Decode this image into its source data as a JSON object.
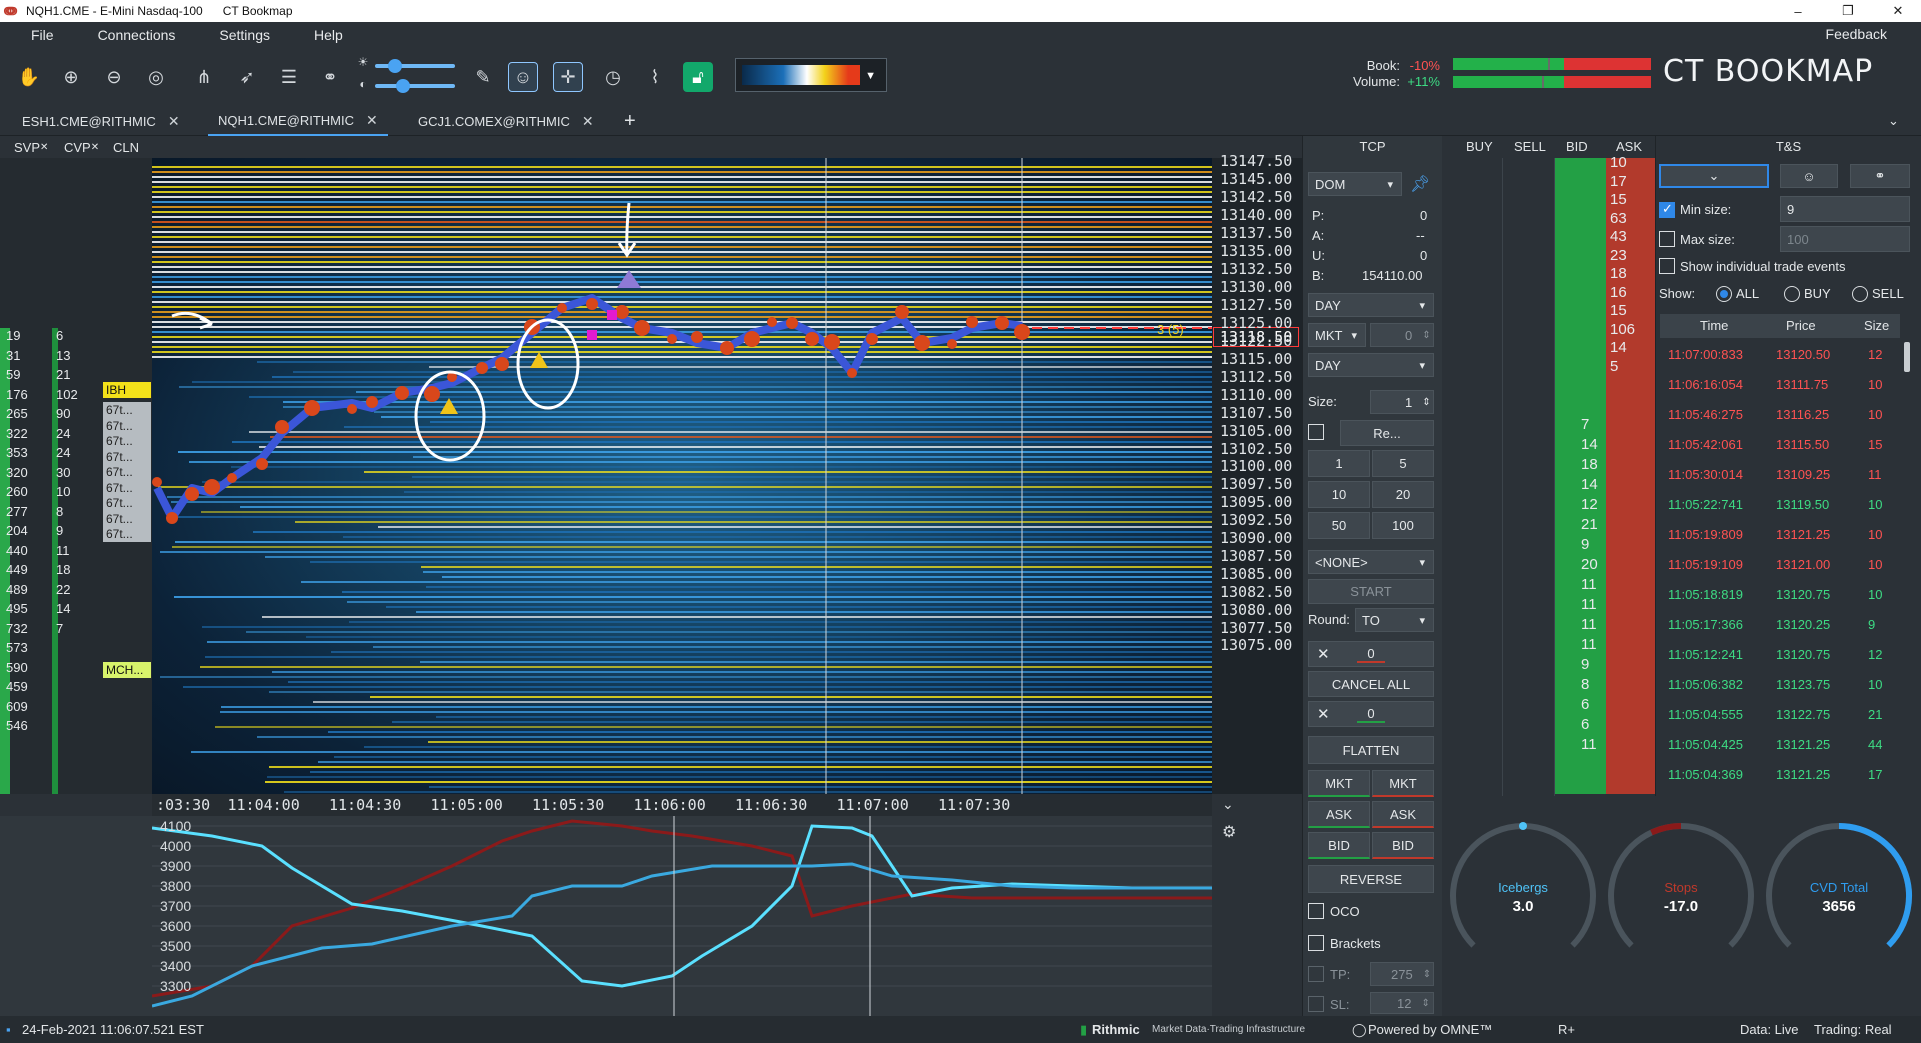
{
  "window": {
    "title": "NQH1.CME - E-Mini Nasdaq-100",
    "app_name": "CT Bookmap",
    "controls": [
      "–",
      "❐",
      "✕"
    ]
  },
  "menu": {
    "items": [
      "File",
      "Connections",
      "Settings",
      "Help"
    ],
    "feedback": "Feedback"
  },
  "toolbar": {
    "icons": [
      "hand-icon",
      "zoom-in-icon",
      "zoom-out-icon",
      "zoom-fit-icon",
      "share-icon",
      "rocket-icon",
      "layers-icon",
      "link-icon",
      "brightness-icon",
      "contrast-icon",
      "pencil-icon",
      "chat-icon",
      "crosshair-icon",
      "timer-icon",
      "chart-icon",
      "lock-icon"
    ],
    "book_label": "Book:",
    "book_value": "-10%",
    "volume_label": "Volume:",
    "volume_value": "+11%",
    "brand": "CT BOOKMAP"
  },
  "tabs": [
    {
      "label": "ESH1.CME@RITHMIC",
      "active": false
    },
    {
      "label": "NQH1.CME@RITHMIC",
      "active": true
    },
    {
      "label": "GCJ1.COMEX@RITHMIC",
      "active": false
    }
  ],
  "add_tab": "+",
  "left_headers": [
    "SVP",
    "CVP",
    "CLN"
  ],
  "svp_values": [
    "19",
    "31",
    "59",
    "176",
    "265",
    "322",
    "353",
    "320",
    "260",
    "277",
    "204",
    "440",
    "449",
    "489",
    "495",
    "732",
    "573",
    "590",
    "459",
    "609",
    "546"
  ],
  "cvp_values": [
    "6",
    "13",
    "21",
    "102",
    "90",
    "24",
    "24",
    "30",
    "10",
    "8",
    "9",
    "11",
    "18",
    "22",
    "14",
    "7"
  ],
  "cln_labels": {
    "ibh": "IBH",
    "mch": "MCH...",
    "rows": [
      "67t...",
      "67t...",
      "67t...",
      "67t...",
      "67t...",
      "67t...",
      "67t...",
      "67t...",
      "67t..."
    ]
  },
  "price_axis": [
    "13147.50",
    "13145.00",
    "13142.50",
    "13140.00",
    "13137.50",
    "13135.00",
    "13132.50",
    "13130.00",
    "13127.50",
    "13125.00",
    "13122.50",
    "13118.50",
    "13115.00",
    "13112.50",
    "13110.00",
    "13107.50",
    "13105.00",
    "13102.50",
    "13100.00",
    "13097.50",
    "13095.00",
    "13092.50",
    "13090.00",
    "13087.50",
    "13085.00",
    "13082.50",
    "13080.00",
    "13077.50",
    "13075.00"
  ],
  "current_price": "13118.50",
  "position_marker": "3 (5)",
  "time_axis": [
    ":03:30",
    "11:04:00",
    "11:04:30",
    "11:05:00",
    "11:05:30",
    "11:06:00",
    "11:06:30",
    "11:07:00",
    "11:07:30"
  ],
  "indicator_axis": [
    "4100",
    "4000",
    "3900",
    "3800",
    "3700",
    "3600",
    "3500",
    "3400",
    "3300"
  ],
  "tcp": {
    "title": "TCP",
    "mode": "DOM",
    "p_label": "P:",
    "p_value": "0",
    "a_label": "A:",
    "a_value": "--",
    "u_label": "U:",
    "u_value": "0",
    "b_label": "B:",
    "b_value": "154110.00",
    "duration1": "DAY",
    "order_type": "MKT",
    "order_qty": "0",
    "duration2": "DAY",
    "size_label": "Size:",
    "size_value": "1",
    "reset_label": "Re...",
    "size_buttons": [
      "1",
      "5",
      "10",
      "20",
      "50",
      "100"
    ],
    "strategy": "<NONE>",
    "start": "START",
    "round_label": "Round:",
    "round_value": "TO",
    "cancel_qty1": "0",
    "cancel_all": "CANCEL ALL",
    "cancel_qty2": "0",
    "flatten": "FLATTEN",
    "buy_mkt": "MKT",
    "sell_mkt": "MKT",
    "buy_ask": "ASK",
    "sell_ask": "ASK",
    "buy_bid": "BID",
    "sell_bid": "BID",
    "reverse": "REVERSE",
    "oco": "OCO",
    "brackets": "Brackets",
    "tp_label": "TP:",
    "tp_value": "275",
    "sl_label": "SL:",
    "sl_value": "12"
  },
  "dom": {
    "headers": [
      "BUY",
      "SELL",
      "BID",
      "ASK"
    ],
    "ask_sizes": [
      "10",
      "17",
      "15",
      "63",
      "43",
      "23",
      "18",
      "16",
      "15",
      "106",
      "14",
      "5"
    ],
    "bid_sizes": [
      "7",
      "14",
      "18",
      "14",
      "12",
      "21",
      "9",
      "20",
      "11",
      "11",
      "11",
      "11",
      "9",
      "8",
      "6",
      "6",
      "11"
    ]
  },
  "ts": {
    "title": "T&S",
    "min_size_label": "Min size:",
    "min_size_value": "9",
    "max_size_label": "Max size:",
    "max_size_placeholder": "100",
    "show_individual": "Show individual trade events",
    "show_label": "Show:",
    "show_options": [
      "ALL",
      "BUY",
      "SELL"
    ],
    "columns": [
      "Time",
      "Price",
      "Size"
    ],
    "rows": [
      {
        "time": "11:07:00:833",
        "price": "13120.50",
        "size": "12",
        "side": "sell"
      },
      {
        "time": "11:06:16:054",
        "price": "13111.75",
        "size": "10",
        "side": "sell"
      },
      {
        "time": "11:05:46:275",
        "price": "13116.25",
        "size": "10",
        "side": "sell"
      },
      {
        "time": "11:05:42:061",
        "price": "13115.50",
        "size": "15",
        "side": "sell"
      },
      {
        "time": "11:05:30:014",
        "price": "13109.25",
        "size": "11",
        "side": "sell"
      },
      {
        "time": "11:05:22:741",
        "price": "13119.50",
        "size": "10",
        "side": "buy"
      },
      {
        "time": "11:05:19:809",
        "price": "13121.25",
        "size": "10",
        "side": "sell"
      },
      {
        "time": "11:05:19:109",
        "price": "13121.00",
        "size": "10",
        "side": "sell"
      },
      {
        "time": "11:05:18:819",
        "price": "13120.75",
        "size": "10",
        "side": "buy"
      },
      {
        "time": "11:05:17:366",
        "price": "13120.25",
        "size": "9",
        "side": "buy"
      },
      {
        "time": "11:05:12:241",
        "price": "13120.75",
        "size": "12",
        "side": "buy"
      },
      {
        "time": "11:05:06:382",
        "price": "13123.75",
        "size": "10",
        "side": "buy"
      },
      {
        "time": "11:05:04:555",
        "price": "13122.75",
        "size": "21",
        "side": "buy"
      },
      {
        "time": "11:05:04:425",
        "price": "13121.25",
        "size": "44",
        "side": "buy"
      },
      {
        "time": "11:05:04:369",
        "price": "13121.25",
        "size": "17",
        "side": "buy"
      }
    ]
  },
  "gauges": [
    {
      "label": "Icebergs",
      "value": "3.0",
      "color": "#4fc3f7"
    },
    {
      "label": "Stops",
      "value": "-17.0",
      "color": "#c0392b"
    },
    {
      "label": "CVD Total",
      "value": "3656",
      "color": "#2f9df0"
    }
  ],
  "status": {
    "datetime": "24-Feb-2021 11:06:07.521 EST",
    "rithmic": "Rithmic",
    "rithmic_tag": "Market Data·Trading Infrastructure",
    "powered": "Powered by OMNE™",
    "rplus": "R+",
    "data": "Data: Live",
    "trading": "Trading: Real"
  },
  "colors": {
    "bg": "#2b3137",
    "bid": "#23a045",
    "ask": "#b23a2c",
    "accent": "#4aa3f2",
    "buy_text": "#3ddc84",
    "sell_text": "#ff5252"
  }
}
